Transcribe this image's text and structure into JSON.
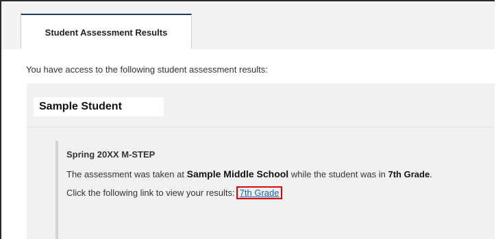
{
  "tabs": [
    {
      "label": "Student Assessment Results",
      "active": true
    }
  ],
  "intro_text": "You have access to the following student assessment results:",
  "student": {
    "name": "Sample Student"
  },
  "assessment": {
    "title": "Spring 20XX M-STEP",
    "line_prefix": "The assessment was taken at",
    "school": "Sample Middle School",
    "line_middle": "while the student was in",
    "grade": "7th Grade",
    "line_suffix": ".",
    "link_prefix": "Click the following link to view your results:",
    "link_label": "7th Grade"
  },
  "colors": {
    "tab_accent": "#1f3a5a",
    "link": "#1a5fb4",
    "highlight_box": "#e00000"
  }
}
